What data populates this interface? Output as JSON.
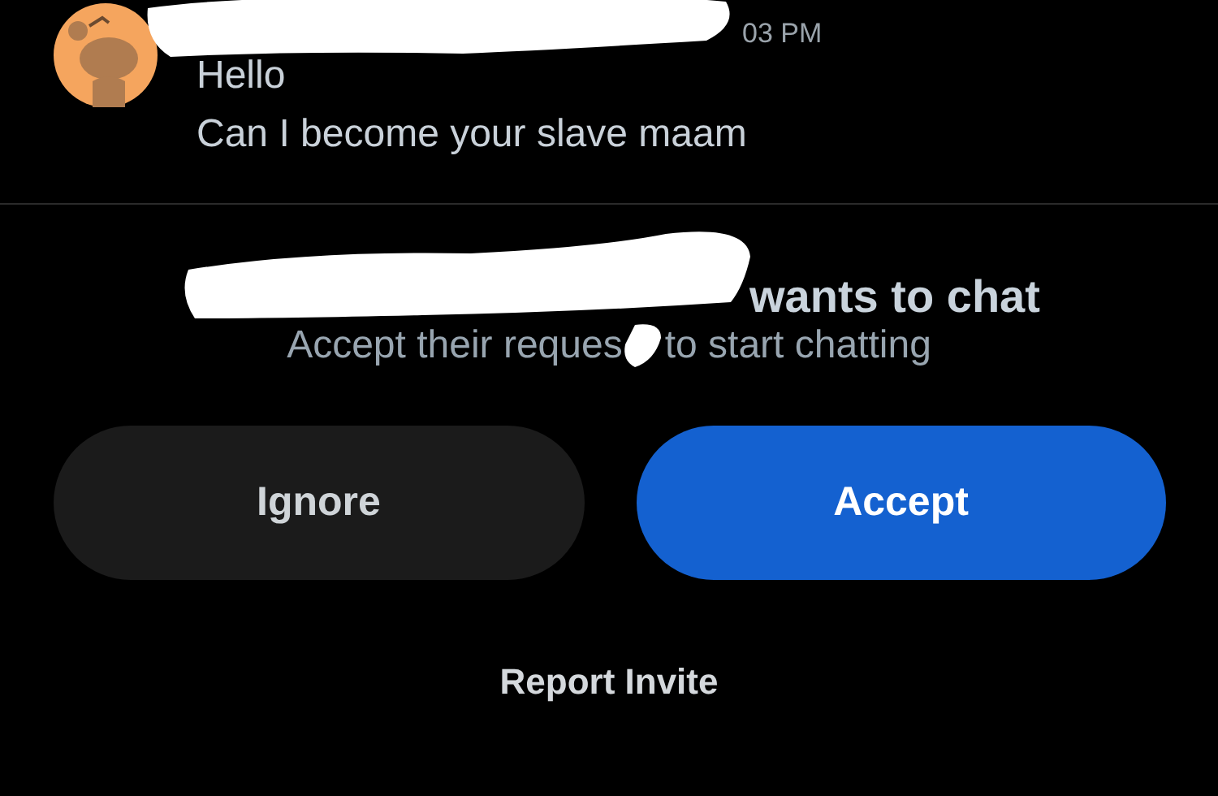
{
  "message": {
    "time": "03 PM",
    "lines": [
      "Hello",
      "Can I become your slave maam"
    ]
  },
  "request": {
    "title": "wants to chat",
    "subtitle_start": "Accept their reques",
    "subtitle_end": "to start chatting"
  },
  "buttons": [
    {
      "label": "Ignore",
      "kind": "secondary"
    },
    {
      "label": "Accept",
      "kind": "primary"
    }
  ],
  "report_link": "Report Invite"
}
